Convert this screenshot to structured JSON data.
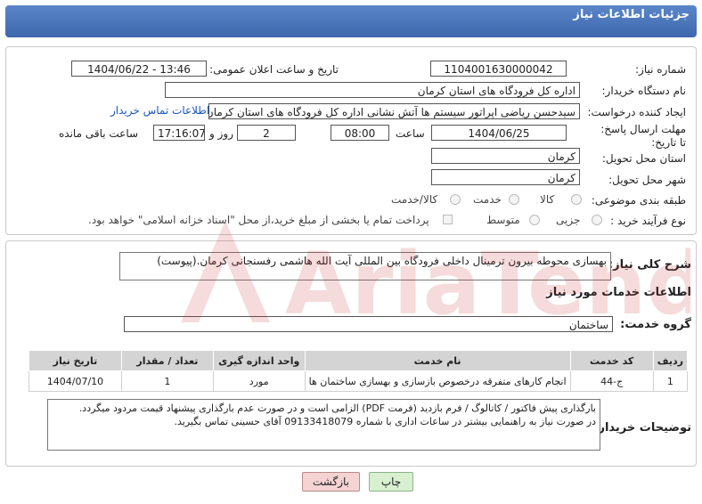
{
  "header": {
    "title": "جزئیات اطلاعات نیاز"
  },
  "form": {
    "need_number_label": "شماره نیاز:",
    "need_number": "1104001630000042",
    "announce_datetime_label": "تاریخ و ساعت اعلان عمومی:",
    "announce_datetime": "1404/06/22 - 13:46",
    "buyer_org_label": "نام دستگاه خریدار:",
    "buyer_org": "اداره کل فرودگاه های استان کرمان",
    "requester_label": "ایجاد کننده درخواست:",
    "requester": "سیدحسن ریاضی اپراتور سیستم ها آتش نشانی اداره کل فرودگاه های استان کرمان",
    "buyer_contact_link": "اطلاعات تماس خریدار",
    "deadline_label": "مهلت ارسال پاسخ: تا تاریخ:",
    "deadline_date": "1404/06/25",
    "time_label": "ساعت",
    "deadline_time": "08:00",
    "days_value": "2",
    "days_label": "روز و",
    "remaining_time": "17:16:07",
    "remaining_label": "ساعت باقی مانده",
    "delivery_province_label": "استان محل تحویل:",
    "delivery_province": "کرمان",
    "delivery_city_label": "شهر محل تحویل:",
    "delivery_city": "کرمان",
    "category_label": "طبقه بندی موضوعی:",
    "category_options": [
      "کالا",
      "خدمت",
      "کالا/خدمت"
    ],
    "process_label": "نوع فرآیند خرید :",
    "process_options": [
      "جزیی",
      "متوسط"
    ],
    "payment_note": "پرداخت تمام یا بخشی از مبلغ خرید،از محل \"اسناد خزانه اسلامی\" خواهد بود."
  },
  "summary": {
    "label": "شرح کلی نیاز:",
    "text": "بهسازی محوطه بیرون ترمینال داخلی فرودگاه بین المللی آیت الله هاشمی رفسنجانی کرمان.(پیوست)"
  },
  "services": {
    "section_title": "اطلاعات خدمات مورد نیاز",
    "group_label": "گروه خدمت:",
    "group_value": "ساختمان",
    "columns": [
      "ردیف",
      "کد خدمت",
      "نام خدمت",
      "واحد اندازه گیری",
      "تعداد / مقدار",
      "تاریخ نیاز"
    ],
    "rows": [
      [
        "1",
        "ج-44",
        "انجام کارهای متفرقه درخصوص بازسازی و بهسازی ساختمان ها",
        "مورد",
        "1",
        "1404/07/10"
      ]
    ]
  },
  "buyer_notes": {
    "label": "توضیحات خریدار:",
    "line1": "بارگذاری پیش فاکتور / کاتالوگ / فرم بازدید (فرمت PDF) الزامی است و در صورت عدم بارگذاری پیشنهاد قیمت مردود میگردد.",
    "line2": "در صورت نیاز به راهنمایی بیشتر در ساعات اداری با شماره 09133418079 آقای حسینی تماس بگیرید."
  },
  "buttons": {
    "print": "چاپ",
    "back": "بازگشت"
  },
  "watermark": {
    "text": "AriaTender.net"
  },
  "colors": {
    "header": "#4a76bb",
    "link": "#1a56c4",
    "back_button": "#f6d3d3",
    "print_button": "#d6f0d0"
  }
}
